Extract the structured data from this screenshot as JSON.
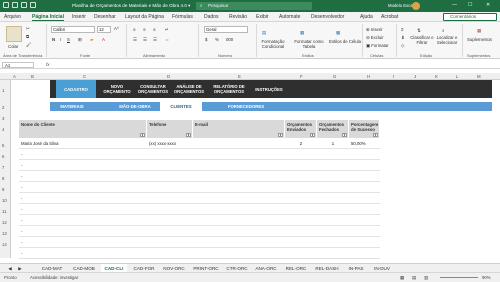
{
  "titlebar": {
    "title": "Planilha de Orçamentos de Materiais e Mão de Obra 4.0 ▾",
    "search": "Pesquisar",
    "user": "Modelo Excel",
    "minimize": "—",
    "maximize": "☐",
    "close": "✕"
  },
  "menu": [
    "Arquivo",
    "Página Inicial",
    "Inserir",
    "Desenhar",
    "Layout da Página",
    "Fórmulas",
    "Dados",
    "Revisão",
    "Exibir",
    "Automate",
    "Desenvolvedor",
    "Ajuda",
    "Acrobat"
  ],
  "comments_label": "Comentários",
  "ribbon": {
    "paste": "Colar",
    "clipboard": "Área de Transferência",
    "font_name": "Calibri",
    "font_size": "12",
    "font_group": "Fonte",
    "align_group": "Alinhamento",
    "number_format": "Geral",
    "number_group": "Número",
    "conditional": "Formatação Condicional",
    "format_table": "Formatar como Tabela",
    "cell_styles": "Estilos de Célula",
    "styles_group": "Estilos",
    "insert": "Inserir",
    "delete": "Excluir",
    "format": "Formatar",
    "cells_group": "Células",
    "sort": "Classificar e Filtrar",
    "find": "Localizar e Selecionar",
    "edit_group": "Edição",
    "addins": "Suplementos",
    "addins_group": "Suplementos"
  },
  "namebox": "A1",
  "fx": "fx",
  "columns": [
    "A",
    "B",
    "C",
    "D",
    "E",
    "F",
    "G",
    "H",
    "I",
    "J",
    "K",
    "L",
    "M"
  ],
  "rows": [
    "1",
    "2",
    "3",
    "4",
    "5",
    "6",
    "7",
    "8",
    "9",
    "10",
    "11",
    "12",
    "13",
    "14",
    "15",
    "16",
    "17",
    "18"
  ],
  "nav": [
    "CADASTRO",
    "NOVO ORÇAMENTO",
    "CONSULTAR ORÇAMENTOS",
    "ANÁLISE DE ORÇAMENTOS",
    "RELATÓRIO DE ORÇAMENTOS",
    "INSTRUÇÕES"
  ],
  "subnav": [
    "MATERIAIS",
    "MÃO-DE-OBRA",
    "CLIENTES",
    "FORNECEDORES"
  ],
  "table": {
    "headers": [
      "Nome do Cliente",
      "Telefone",
      "E-mail",
      "Orçamentos Enviados",
      "Orçamentos Fechados",
      "Porcentagem de Sucesso"
    ],
    "rows": [
      [
        "Maria José da Silva",
        "(xx) xxxx-xxxx",
        "",
        "2",
        "1",
        "50,00%"
      ],
      [
        "-",
        "",
        "",
        "",
        "",
        ""
      ],
      [
        "-",
        "",
        "",
        "",
        "",
        ""
      ],
      [
        "-",
        "",
        "",
        "",
        "",
        ""
      ],
      [
        "-",
        "",
        "",
        "",
        "",
        ""
      ],
      [
        "-",
        "",
        "",
        "",
        "",
        ""
      ],
      [
        "-",
        "",
        "",
        "",
        "",
        ""
      ],
      [
        "-",
        "",
        "",
        "",
        "",
        ""
      ],
      [
        "-",
        "",
        "",
        "",
        "",
        ""
      ],
      [
        "-",
        "",
        "",
        "",
        "",
        ""
      ],
      [
        "-",
        "",
        "",
        "",
        "",
        ""
      ]
    ]
  },
  "sheet_tabs": [
    "CAD-MAT",
    "CAD-MOB",
    "CAD-CLI",
    "CAD-FOR",
    "NOV-ORC",
    "PRINT-ORC",
    "CTR-ORC",
    "ANA-ORC",
    "REL-ORC",
    "REL-DASH",
    "IN-PAS",
    "IN-DUV"
  ],
  "status": {
    "ready": "Pronto",
    "accessibility": "Acessibilidade: investigar",
    "zoom": "90%"
  }
}
